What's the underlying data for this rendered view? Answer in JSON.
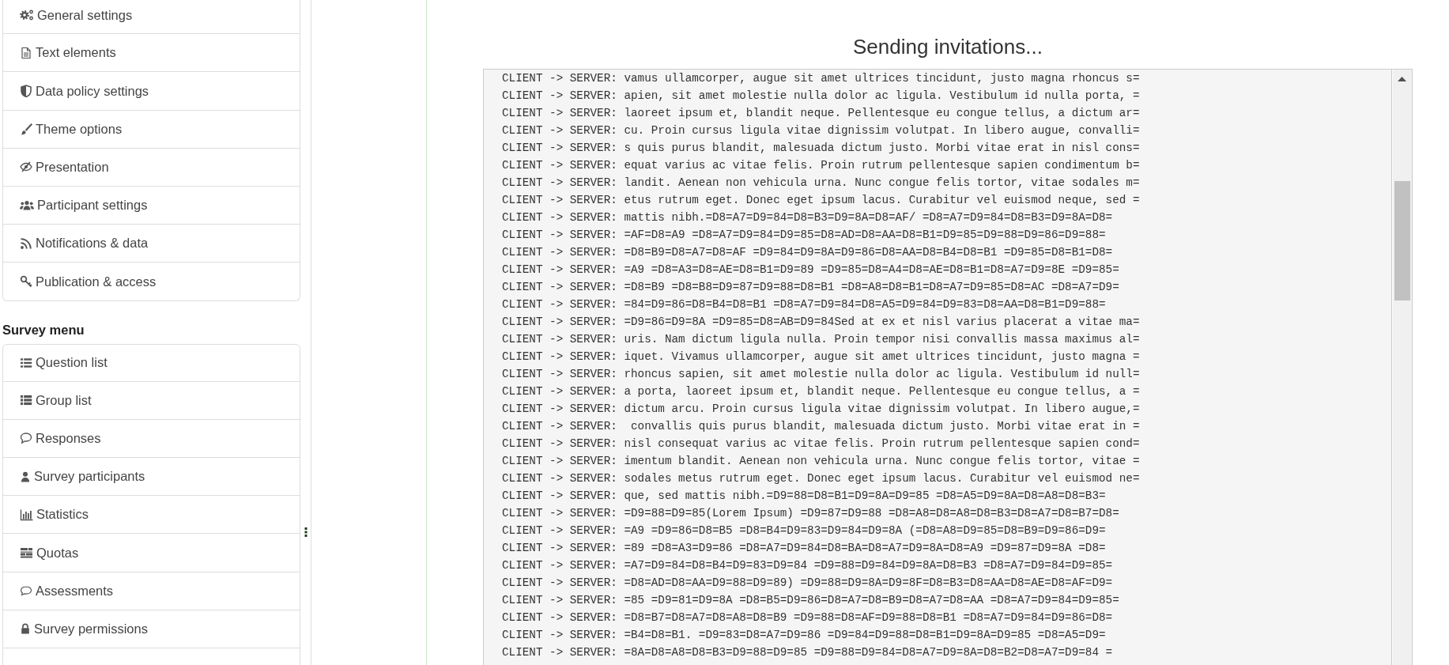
{
  "sidebar": {
    "settings_menu": [
      {
        "label": "General settings",
        "selected": false
      },
      {
        "label": "Text elements",
        "selected": false
      },
      {
        "label": "Data policy settings",
        "selected": false
      },
      {
        "label": "Theme options",
        "selected": false
      },
      {
        "label": "Presentation",
        "selected": false
      },
      {
        "label": "Participant settings",
        "selected": false
      },
      {
        "label": "Notifications & data",
        "selected": false
      },
      {
        "label": "Publication & access",
        "selected": false
      }
    ],
    "survey_menu": {
      "heading": "Survey menu",
      "items": [
        {
          "label": "Question list",
          "selected": false
        },
        {
          "label": "Group list",
          "selected": false
        },
        {
          "label": "Responses",
          "selected": false
        },
        {
          "label": "Survey participants",
          "selected": false
        },
        {
          "label": "Statistics",
          "selected": false
        },
        {
          "label": "Quotas",
          "selected": false
        },
        {
          "label": "Assessments",
          "selected": false
        },
        {
          "label": "Survey permissions",
          "selected": false
        }
      ]
    }
  },
  "main": {
    "title": "Sending invitations...",
    "log": {
      "lines": [
        "CLIENT -> SERVER: vamus ullamcorper, augue sit amet ultrices tincidunt, justo magna rhoncus s=",
        "CLIENT -> SERVER: apien, sit amet molestie nulla dolor ac ligula. Vestibulum id nulla porta, =",
        "CLIENT -> SERVER: laoreet ipsum et, blandit neque. Pellentesque eu congue tellus, a dictum ar=",
        "CLIENT -> SERVER: cu. Proin cursus ligula vitae dignissim volutpat. In libero augue, convalli=",
        "CLIENT -> SERVER: s quis purus blandit, malesuada dictum justo. Morbi vitae erat in nisl cons=",
        "CLIENT -> SERVER: equat varius ac vitae felis. Proin rutrum pellentesque sapien condimentum b=",
        "CLIENT -> SERVER: landit. Aenean non vehicula urna. Nunc congue felis tortor, vitae sodales m=",
        "CLIENT -> SERVER: etus rutrum eget. Donec eget ipsum lacus. Curabitur vel euismod neque, sed =",
        "CLIENT -> SERVER: mattis nibh.=D8=A7=D9=84=D8=B3=D9=8A=D8=AF/ =D8=A7=D9=84=D8=B3=D9=8A=D8=",
        "CLIENT -> SERVER: =AF=D8=A9 =D8=A7=D9=84=D9=85=D8=AD=D8=AA=D8=B1=D9=85=D9=88=D9=86=D9=88=",
        "CLIENT -> SERVER: =D8=B9=D8=A7=D8=AF =D9=84=D9=8A=D9=86=D8=AA=D8=B4=D8=B1 =D9=85=D8=B1=D8=",
        "CLIENT -> SERVER: =A9 =D8=A3=D8=AE=D8=B1=D9=89 =D9=85=D8=A4=D8=AE=D8=B1=D8=A7=D9=8E =D9=85=",
        "CLIENT -> SERVER: =D8=B9 =D8=B8=D9=87=D9=88=D8=B1 =D8=A8=D8=B1=D8=A7=D9=85=D8=AC =D8=A7=D9=",
        "CLIENT -> SERVER: =84=D9=86=D8=B4=D8=B1 =D8=A7=D9=84=D8=A5=D9=84=D9=83=D8=AA=D8=B1=D9=88=",
        "CLIENT -> SERVER: =D9=86=D9=8A =D9=85=D8=AB=D9=84Sed at ex et nisl varius placerat a vitae ma=",
        "CLIENT -> SERVER: uris. Nam dictum ligula nulla. Proin tempor nisi convallis massa maximus al=",
        "CLIENT -> SERVER: iquet. Vivamus ullamcorper, augue sit amet ultrices tincidunt, justo magna =",
        "CLIENT -> SERVER: rhoncus sapien, sit amet molestie nulla dolor ac ligula. Vestibulum id null=",
        "CLIENT -> SERVER: a porta, laoreet ipsum et, blandit neque. Pellentesque eu congue tellus, a =",
        "CLIENT -> SERVER: dictum arcu. Proin cursus ligula vitae dignissim volutpat. In libero augue,=",
        "CLIENT -> SERVER:  convallis quis purus blandit, malesuada dictum justo. Morbi vitae erat in =",
        "CLIENT -> SERVER: nisl consequat varius ac vitae felis. Proin rutrum pellentesque sapien cond=",
        "CLIENT -> SERVER: imentum blandit. Aenean non vehicula urna. Nunc congue felis tortor, vitae =",
        "CLIENT -> SERVER: sodales metus rutrum eget. Donec eget ipsum lacus. Curabitur vel euismod ne=",
        "CLIENT -> SERVER: que, sed mattis nibh.=D9=88=D8=B1=D9=8A=D9=85 =D8=A5=D9=8A=D8=A8=D8=B3=",
        "CLIENT -> SERVER: =D9=88=D9=85(Lorem Ipsum) =D9=87=D9=88 =D8=A8=D8=A8=D8=B3=D8=A7=D8=B7=D8=",
        "CLIENT -> SERVER: =A9 =D9=86=D8=B5 =D8=B4=D9=83=D9=84=D9=8A (=D8=A8=D9=85=D8=B9=D9=86=D9=",
        "CLIENT -> SERVER: =89 =D8=A3=D9=86 =D8=A7=D9=84=D8=BA=D8=A7=D9=8A=D8=A9 =D9=87=D9=8A =D8=",
        "CLIENT -> SERVER: =A7=D9=84=D8=B4=D9=83=D9=84 =D9=88=D9=84=D9=8A=D8=B3 =D8=A7=D9=84=D9=85=",
        "CLIENT -> SERVER: =D8=AD=D8=AA=D9=88=D9=89) =D9=88=D9=8A=D9=8F=D8=B3=D8=AA=D8=AE=D8=AF=D9=",
        "CLIENT -> SERVER: =85 =D9=81=D9=8A =D8=B5=D9=86=D8=A7=D8=B9=D8=A7=D8=AA =D8=A7=D9=84=D9=85=",
        "CLIENT -> SERVER: =D8=B7=D8=A7=D8=A8=D8=B9 =D9=88=D8=AF=D9=88=D8=B1 =D8=A7=D9=84=D9=86=D8=",
        "CLIENT -> SERVER: =B4=D8=B1. =D9=83=D8=A7=D9=86 =D9=84=D9=88=D8=B1=D9=8A=D9=85 =D8=A5=D9=",
        "CLIENT -> SERVER: =8A=D8=A8=D8=B3=D9=88=D9=85 =D9=88=D9=84=D8=A7=D9=8A=D8=B2=D8=A7=D9=84 ="
      ]
    }
  }
}
